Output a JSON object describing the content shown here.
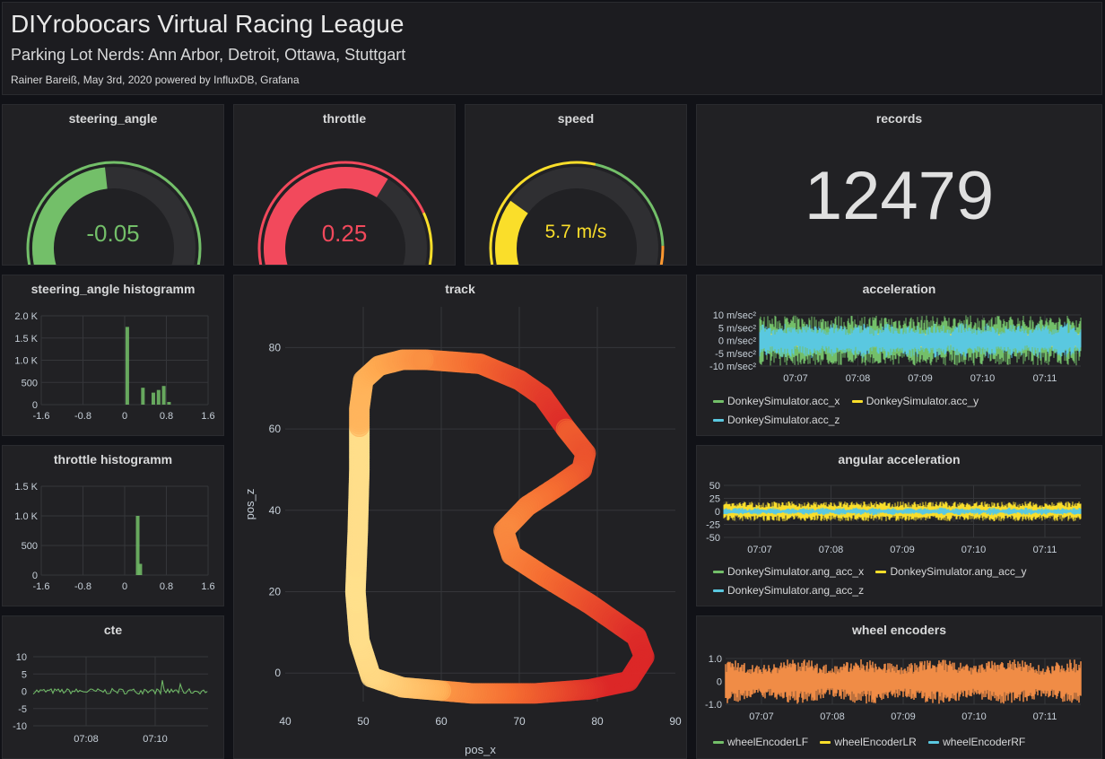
{
  "header": {
    "title": "DIYrobocars Virtual Racing League",
    "subtitle": "Parking Lot Nerds: Ann Arbor, Detroit, Ottawa, Stuttgart",
    "credits": "Rainer Bareiß, May 3rd, 2020 powered by InfluxDB, Grafana"
  },
  "gauges": {
    "steering": {
      "title": "steering_angle",
      "value_text": "-0.05",
      "value": -0.05,
      "min": -1,
      "max": 1,
      "color": "#73bf69"
    },
    "throttle": {
      "title": "throttle",
      "value_text": "0.25",
      "value": 0.25,
      "min": -1,
      "max": 1,
      "color": "#f2495c"
    },
    "speed": {
      "title": "speed",
      "value_text": "5.7 m/s",
      "value": 5.7,
      "min": 0,
      "max": 20,
      "color": "#fade2a"
    }
  },
  "records": {
    "title": "records",
    "value": "12479"
  },
  "colors": {
    "green": "#73bf69",
    "yellow": "#fade2a",
    "red": "#f2495c",
    "orange": "#ff9830",
    "blue": "#5ac8e0",
    "encoder": "#f08c46"
  },
  "chart_data": [
    {
      "id": "steering_hist",
      "type": "bar",
      "title": "steering_angle histogramm",
      "xlim": [
        -1.6,
        1.6
      ],
      "xticks": [
        "-1.6",
        "-0.8",
        "0",
        "0.8",
        "1.6"
      ],
      "ylim": [
        0,
        2000
      ],
      "yticks": [
        "0",
        "500",
        "1.0 K",
        "1.5 K",
        "2.0 K"
      ],
      "bins": [
        {
          "x": 0.05,
          "y": 1750
        },
        {
          "x": 0.35,
          "y": 380
        },
        {
          "x": 0.55,
          "y": 270
        },
        {
          "x": 0.65,
          "y": 330
        },
        {
          "x": 0.75,
          "y": 420
        },
        {
          "x": 0.85,
          "y": 60
        }
      ]
    },
    {
      "id": "throttle_hist",
      "type": "bar",
      "title": "throttle histogramm",
      "xlim": [
        -1.6,
        1.6
      ],
      "xticks": [
        "-1.6",
        "-0.8",
        "0",
        "0.8",
        "1.6"
      ],
      "ylim": [
        0,
        1500
      ],
      "yticks": [
        "0",
        "500",
        "1.0 K",
        "1.5 K"
      ],
      "bins": [
        {
          "x": 0.25,
          "y": 1000
        },
        {
          "x": 0.3,
          "y": 190
        }
      ]
    },
    {
      "id": "cte",
      "type": "line",
      "title": "cte",
      "ylim": [
        -10,
        10
      ],
      "yticks": [
        "-10",
        "-5",
        "0",
        "5",
        "10"
      ],
      "xticks": [
        "07:08",
        "07:10"
      ],
      "series_color": "#73bf69"
    },
    {
      "id": "track",
      "type": "scatter",
      "title": "track",
      "xlabel": "pos_x",
      "ylabel": "pos_z",
      "xlim": [
        40,
        90
      ],
      "ylim": [
        -7,
        90
      ],
      "xticks": [
        "40",
        "50",
        "60",
        "70",
        "80",
        "90"
      ],
      "yticks": [
        "0",
        "20",
        "40",
        "60",
        "80"
      ],
      "path": [
        [
          58,
          77
        ],
        [
          65,
          76
        ],
        [
          70,
          72
        ],
        [
          73,
          68
        ],
        [
          76,
          60
        ],
        [
          78.5,
          54
        ],
        [
          78,
          50
        ],
        [
          75,
          46
        ],
        [
          71,
          41
        ],
        [
          68,
          35
        ],
        [
          69,
          29
        ],
        [
          73,
          24
        ],
        [
          79,
          17
        ],
        [
          85,
          9
        ],
        [
          86,
          4
        ],
        [
          84,
          -2
        ],
        [
          79,
          -4
        ],
        [
          72,
          -5
        ],
        [
          64,
          -5
        ],
        [
          55,
          -3.5
        ],
        [
          51,
          -1
        ],
        [
          49.5,
          8
        ],
        [
          49,
          20
        ],
        [
          49.3,
          35
        ],
        [
          49.5,
          50
        ],
        [
          49.5,
          65
        ],
        [
          50,
          72
        ],
        [
          52,
          75.5
        ],
        [
          55,
          77
        ],
        [
          58,
          77
        ]
      ]
    },
    {
      "id": "acceleration",
      "type": "line",
      "title": "acceleration",
      "ylim": [
        -10,
        10
      ],
      "yticks": [
        "10 m/sec²",
        "5 m/sec²",
        "0 m/sec²",
        "-5 m/sec²",
        "-10 m/sec²"
      ],
      "xticks": [
        "07:07",
        "07:08",
        "07:09",
        "07:10",
        "07:11"
      ],
      "series": [
        {
          "name": "DonkeySimulator.acc_x",
          "color": "#73bf69"
        },
        {
          "name": "DonkeySimulator.acc_y",
          "color": "#fade2a"
        },
        {
          "name": "DonkeySimulator.acc_z",
          "color": "#5ac8e0"
        }
      ]
    },
    {
      "id": "angular",
      "type": "line",
      "title": "angular acceleration",
      "ylim": [
        -50,
        50
      ],
      "yticks": [
        "50",
        "25",
        "0",
        "-25",
        "-50"
      ],
      "xticks": [
        "07:07",
        "07:08",
        "07:09",
        "07:10",
        "07:11"
      ],
      "series": [
        {
          "name": "DonkeySimulator.ang_acc_x",
          "color": "#73bf69"
        },
        {
          "name": "DonkeySimulator.ang_acc_y",
          "color": "#fade2a"
        },
        {
          "name": "DonkeySimulator.ang_acc_z",
          "color": "#5ac8e0"
        }
      ]
    },
    {
      "id": "wheel",
      "type": "line",
      "title": "wheel encoders",
      "ylim": [
        -1.2,
        1.2
      ],
      "yticks": [
        "1.0",
        "0",
        "-1.0"
      ],
      "xticks": [
        "07:07",
        "07:08",
        "07:09",
        "07:10",
        "07:11"
      ],
      "series": [
        {
          "name": "wheelEncoderLF",
          "color": "#73bf69"
        },
        {
          "name": "wheelEncoderLR",
          "color": "#fade2a"
        },
        {
          "name": "wheelEncoderRF",
          "color": "#5ac8e0"
        }
      ]
    }
  ]
}
